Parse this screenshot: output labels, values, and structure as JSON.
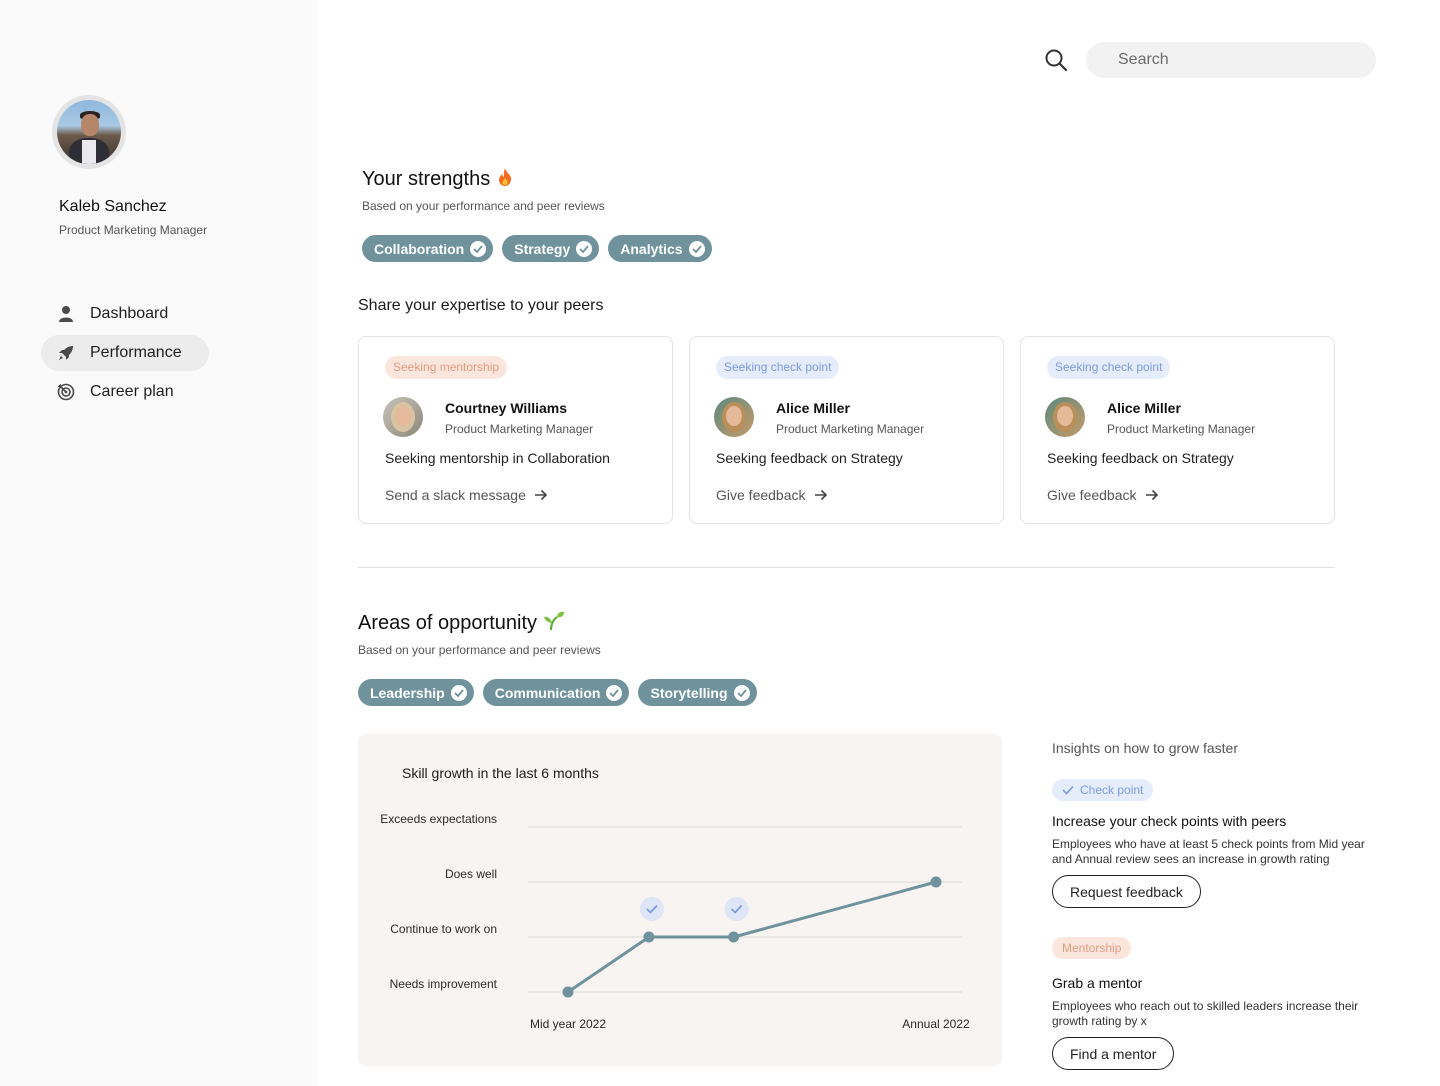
{
  "user": {
    "name": "Kaleb Sanchez",
    "role": "Product Marketing Manager"
  },
  "nav": {
    "items": [
      {
        "label": "Dashboard",
        "icon": "user-icon"
      },
      {
        "label": "Performance",
        "icon": "rocket-icon",
        "active": true
      },
      {
        "label": "Career plan",
        "icon": "target-icon"
      }
    ]
  },
  "search": {
    "placeholder": "Search"
  },
  "strengths": {
    "title": "Your strengths",
    "subtitle": "Based on your performance and peer reviews",
    "chips": [
      "Collaboration",
      "Strategy",
      "Analytics"
    ]
  },
  "share": {
    "title": "Share your expertise to your peers",
    "cards": [
      {
        "tag": "Seeking mentorship",
        "tag_type": "mentor",
        "name": "Courtney Williams",
        "role": "Product Marketing Manager",
        "desc": "Seeking mentorship in Collaboration",
        "action": "Send a slack message"
      },
      {
        "tag": "Seeking check point",
        "tag_type": "check",
        "name": "Alice Miller",
        "role": "Product Marketing Manager",
        "desc": "Seeking feedback on Strategy",
        "action": "Give feedback"
      },
      {
        "tag": "Seeking check point",
        "tag_type": "check",
        "name": "Alice Miller",
        "role": "Product Marketing Manager",
        "desc": "Seeking feedback on Strategy",
        "action": "Give feedback"
      }
    ]
  },
  "opportunity": {
    "title": "Areas of opportunity",
    "subtitle": "Based on your performance and peer reviews",
    "chips": [
      "Leadership",
      "Communication",
      "Storytelling"
    ]
  },
  "chart_data": {
    "type": "line",
    "title": "Skill growth in the last 6 months",
    "y_levels": [
      "Needs improvement",
      "Continue to work on",
      "Does well",
      "Exceeds expectations"
    ],
    "x_labels": [
      "Mid year 2022",
      "Annual 2022"
    ],
    "points": [
      {
        "x": 0,
        "y": 0
      },
      {
        "x": 0.22,
        "y": 1.0,
        "check": true
      },
      {
        "x": 0.45,
        "y": 1.0,
        "check": true
      },
      {
        "x": 1,
        "y": 2.0
      }
    ],
    "colors": {
      "line": "#6f929c",
      "check_bg": "#dde5f6",
      "check": "#7d9be0"
    }
  },
  "insights": {
    "title": "Insights on how to grow faster",
    "items": [
      {
        "tag": "Check point",
        "title": "Increase your check points with peers",
        "body": "Employees who have at least 5 check points from Mid year and Annual review sees an increase in growth rating",
        "button": "Request feedback"
      },
      {
        "tag": "Mentorship",
        "title": "Grab a mentor",
        "body": "Employees who reach out to skilled leaders increase their growth rating by x",
        "button": "Find a mentor"
      }
    ]
  },
  "colors": {
    "chip": "#6f929c",
    "mentor_tag_bg": "#fbe6de",
    "mentor_tag_text": "#e59c80",
    "check_tag_bg": "#e5ecfb",
    "check_tag_text": "#7d9be0"
  }
}
